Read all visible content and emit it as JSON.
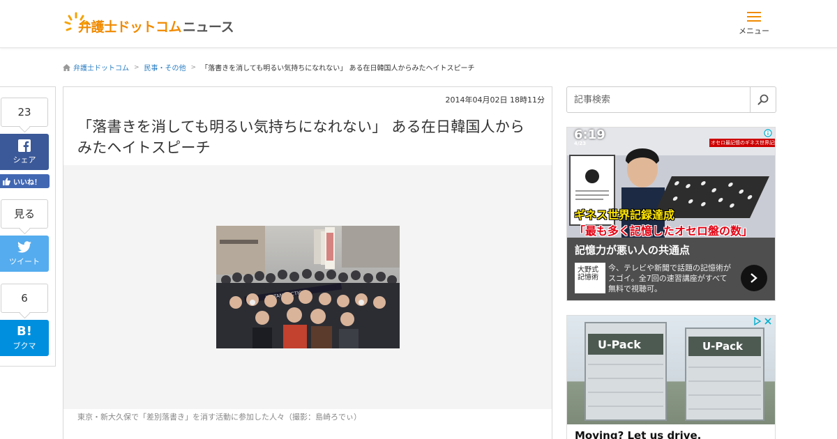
{
  "header": {
    "logo_main": "弁護士ドットコム",
    "logo_sub": "ニュース",
    "menu_label": "メニュー"
  },
  "breadcrumb": {
    "items": [
      "弁護士ドットコム",
      "民事・その他"
    ],
    "current": "「落書きを消しても明るい気持ちになれない」 ある在日韓国人からみたヘイトスピーチ"
  },
  "share": {
    "facebook_count": "23",
    "facebook_label": "シェア",
    "like_label": "いいね！",
    "twitter_count": "見る",
    "twitter_label": "ツイート",
    "hatena_count": "6",
    "hatena_label": "ブクマ",
    "hatena_icon_text": "B!"
  },
  "article": {
    "date": "2014年04月02日 18時11分",
    "title": "「落書きを消しても明るい気持ちになれない」 ある在日韓国人からみたヘイトスピーチ",
    "caption": "東京・新大久保で「差別落書き」を消す活動に参加した人々（撮影：島崎ろでぃ）",
    "photo_banner": "INSTANT ACTION"
  },
  "sidebar": {
    "search_placeholder": "記事検索",
    "ad1": {
      "time": "6:19",
      "date": "4/23",
      "tag": "オセロ最記憶のギネス世界記録保持者",
      "headline_yellow": "ギネス世界記録達成",
      "headline_red": "「最も多く記憶したオセロ盤の数」",
      "headline": "記憶力が悪い人の共通点",
      "body": "今、テレビや新聞で話題の記憶術がスゴイ。全7回の速習講座がすべて無料で視聴可。",
      "logo_text": "大野式記憶術"
    },
    "ad2": {
      "brand": "U-Pack",
      "headline": "Moving? Let us drive."
    }
  },
  "colors": {
    "logo_orange": "#f08a00",
    "link_blue": "#2a7ec3",
    "facebook": "#3b5998",
    "like": "#4267b2",
    "twitter": "#55acee",
    "hatena": "#008fde"
  }
}
